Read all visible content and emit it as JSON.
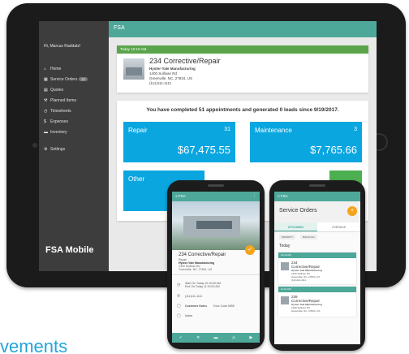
{
  "tablet": {
    "app_title": "FSA",
    "user": "Hi, Marcus Raddatz!",
    "nav": [
      {
        "icon": "home-icon",
        "glyph": "⌂",
        "label": "Home"
      },
      {
        "icon": "calendar-icon",
        "glyph": "▦",
        "label": "Service Orders",
        "badge": "22"
      },
      {
        "icon": "document-icon",
        "glyph": "▤",
        "label": "Quotes"
      },
      {
        "icon": "wrench-icon",
        "glyph": "⚒",
        "label": "Planned Items"
      },
      {
        "icon": "clock-icon",
        "glyph": "◷",
        "label": "Timesheets"
      },
      {
        "icon": "dollar-icon",
        "glyph": "$",
        "label": "Expenses"
      },
      {
        "icon": "truck-icon",
        "glyph": "▬",
        "label": "Inventory"
      },
      {
        "icon": "gear-icon",
        "glyph": "⚙",
        "label": "Settings"
      }
    ],
    "brand": "FSA Mobile",
    "appointment": {
      "time": "Today 10:10 AM",
      "title": "234 Corrective/Repair",
      "company": "Hyster-Yale Manufacturing",
      "street": "1400 Sullivan Rd",
      "city": "Greenville, NC, 27834, US",
      "phone": "(111)111-1111"
    },
    "summary": "You have completed 51 appointments and generated 0 leads since 9/19/2017.",
    "tiles": [
      {
        "label": "Repair",
        "count": "31",
        "amount": "$67,475.55"
      },
      {
        "label": "Maintenance",
        "count": "3",
        "amount": "$7,765.66"
      },
      {
        "label": "Other",
        "count": "",
        "amount": ""
      }
    ]
  },
  "phone1": {
    "title": "FSA",
    "job_title": "234 Corrective/Repair",
    "job_type": "Repair",
    "company": "Hyster-Yale Manufacturing",
    "street": "1400 Sullivan Rd",
    "city": "Greenville, NC, 27834, US",
    "start": "Start On Today 10:10:00 AM",
    "end": "End On Today 11:10:00 AM",
    "phone": "(111)111-1111",
    "customer_notes": "Customer Notes",
    "door_code": "Door Code 5555",
    "notes": "Notes"
  },
  "phone2": {
    "title": "FSA",
    "page_title": "Service Orders",
    "tabs": [
      "UPCOMING",
      "OVERDUE"
    ],
    "subtabs": [
      "PRIORITY",
      "BACKLOG"
    ],
    "day": "Today",
    "orders": [
      {
        "time": "10:10 AM",
        "title": "234",
        "type": "Corrective/Repair",
        "company": "Hyster-Yale Manufacturing",
        "street": "1400 Sullivan Rd",
        "city": "Greenville, NC, 27834, US",
        "extra": "(111)111-1111"
      },
      {
        "time": "11:10 AM",
        "title": "239",
        "type": "Corrective/Repair",
        "company": "Hyster-Yale Manufacturing",
        "street": "1400 Sullivan Rd",
        "city": "Greenville, NC, 27834, US",
        "extra": ""
      }
    ]
  },
  "headline": "vements"
}
